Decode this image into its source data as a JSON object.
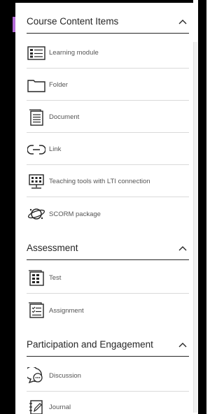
{
  "sections": [
    {
      "title": "Course Content Items",
      "items": [
        {
          "label": "Learning module",
          "icon": "learning-module-icon"
        },
        {
          "label": "Folder",
          "icon": "folder-icon"
        },
        {
          "label": "Document",
          "icon": "document-icon"
        },
        {
          "label": "Link",
          "icon": "link-icon"
        },
        {
          "label": "Teaching tools with LTI connection",
          "icon": "lti-tools-icon"
        },
        {
          "label": "SCORM package",
          "icon": "scorm-package-icon"
        }
      ]
    },
    {
      "title": "Assessment",
      "items": [
        {
          "label": "Test",
          "icon": "test-icon"
        },
        {
          "label": "Assignment",
          "icon": "assignment-icon"
        }
      ]
    },
    {
      "title": "Participation and Engagement",
      "items": [
        {
          "label": "Discussion",
          "icon": "discussion-icon"
        },
        {
          "label": "Journal",
          "icon": "journal-icon"
        }
      ]
    }
  ],
  "colors": {
    "accent": "#b36bd6",
    "text": "#262626",
    "muted": "#555555",
    "divider": "#dadada"
  }
}
